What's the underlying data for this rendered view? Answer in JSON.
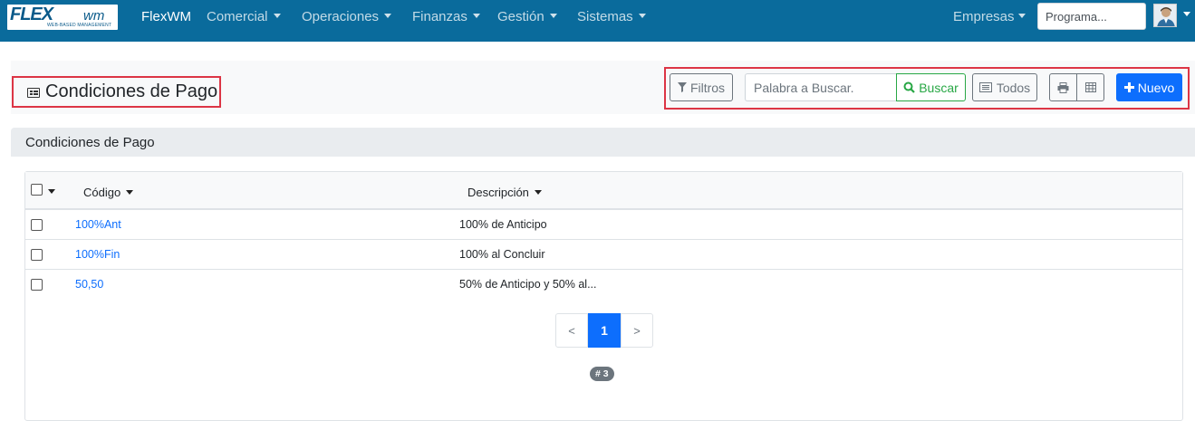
{
  "navbar": {
    "logo_text": "FLEX",
    "logo_wm": "wm",
    "logo_sub": "WEB-BASED MANAGEMENT",
    "brand": "FlexWM",
    "menus": [
      "Comercial",
      "Operaciones",
      "Finanzas",
      "Gestión",
      "Sistemas"
    ],
    "empresas": "Empresas",
    "search_placeholder": "Programa...",
    "bg_color": "#0a6b9c"
  },
  "toolbar": {
    "title": "Condiciones de Pago",
    "filters_label": "Filtros",
    "search_placeholder": "Palabra a Buscar.",
    "search_button": "Buscar",
    "all_button": "Todos",
    "new_button": "Nuevo",
    "highlight_color": "#dc3545"
  },
  "panel": {
    "title": "Condiciones de Pago"
  },
  "table": {
    "headers": [
      "Código",
      "Descripción"
    ],
    "rows": [
      {
        "code": "100%Ant",
        "description": "100% de Anticipo"
      },
      {
        "code": "100%Fin",
        "description": "100% al Concluir"
      },
      {
        "code": "50,50",
        "description": "50% de Anticipo y 50% al..."
      }
    ]
  },
  "pagination": {
    "prev": "<",
    "current": "1",
    "next": ">",
    "count": "# 3"
  }
}
